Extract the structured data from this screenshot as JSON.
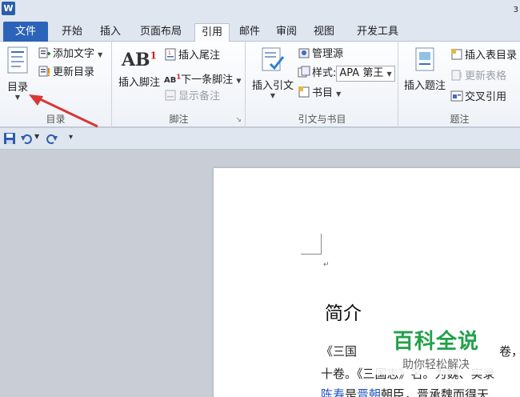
{
  "titlebar": {
    "title_fragment": "з"
  },
  "tabs": [
    {
      "label": "文件"
    },
    {
      "label": "开始"
    },
    {
      "label": "插入"
    },
    {
      "label": "页面布局"
    },
    {
      "label": "引用"
    },
    {
      "label": "邮件"
    },
    {
      "label": "审阅"
    },
    {
      "label": "视图"
    },
    {
      "label": "开发工具"
    }
  ],
  "ribbon": {
    "toc": {
      "big_label": "目录",
      "add_text": "添加文字",
      "update_toc": "更新目录",
      "group_label": "目录"
    },
    "footnotes": {
      "insert_footnote": "插入脚注",
      "insert_endnote": "插入尾注",
      "next_footnote": "下一条脚注",
      "show_notes": "显示备注",
      "group_label": "脚注"
    },
    "citations": {
      "insert_citation": "插入引文",
      "manage_sources": "管理源",
      "style_label": "样式:",
      "style_value": "APA 第王",
      "bibliography": "书目",
      "group_label": "引文与书目"
    },
    "captions": {
      "insert_caption": "插入题注",
      "insert_table_of_figures": "插入表目录",
      "update_table": "更新表格",
      "cross_reference": "交叉引用",
      "group_label": "题注"
    }
  },
  "document": {
    "heading": "简介",
    "para_mark": "↵",
    "line1_a": "《三国",
    "line1_b": "卷，",
    "line2_a": "十卷。《三国志》名。为魏、",
    "line2_b": "实录",
    "line3_link1": "陈寿",
    "line3_mid": "是",
    "line3_link2": "晋朝",
    "line3_rest": "朝臣，晋承魏而得天"
  },
  "watermark": {
    "main": "百科全说",
    "sub": "助你轻松解决"
  },
  "colors": {
    "file_tab": "#2b63b8",
    "accent_red": "#d93636",
    "link": "#1f4fbf",
    "watermark_green": "#22a14b"
  }
}
